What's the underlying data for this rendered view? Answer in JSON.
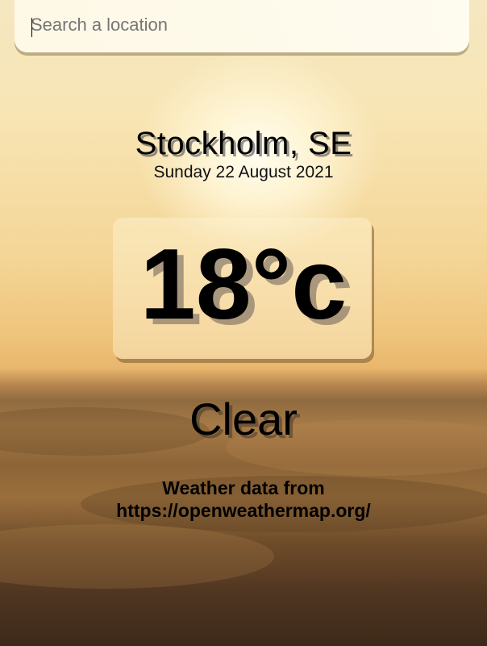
{
  "search": {
    "placeholder": "Search a location",
    "value": ""
  },
  "weather": {
    "location": "Stockholm, SE",
    "date": "Sunday 22 August 2021",
    "temperature": "18°c",
    "condition": "Clear"
  },
  "attribution": {
    "line1": "Weather data from",
    "line2": "https://openweathermap.org/"
  }
}
